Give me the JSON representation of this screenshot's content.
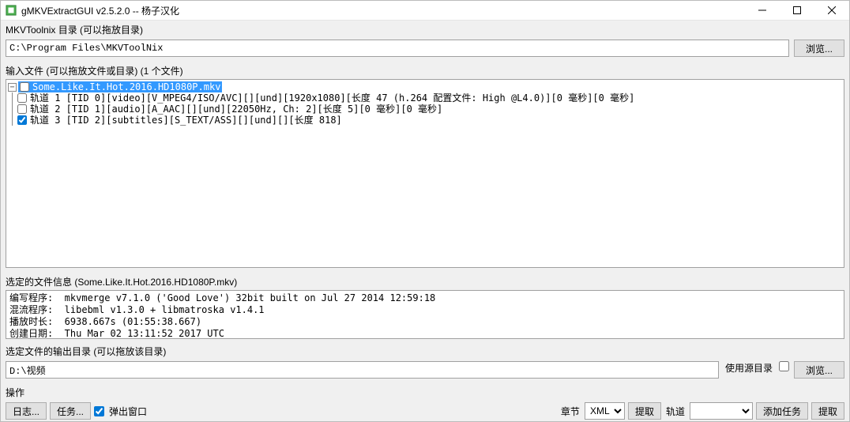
{
  "titlebar": {
    "title": "gMKVExtractGUI v2.5.2.0 -- 杨子汉化"
  },
  "section_mkvtoolnix": {
    "label": "MKVToolnix 目录 (可以拖放目录)",
    "path": "C:\\Program Files\\MKVToolNix",
    "browse": "浏览..."
  },
  "section_input": {
    "label": "输入文件 (可以拖放文件或目录) (1 个文件)"
  },
  "tree": {
    "root": "Some.Like.It.Hot.2016.HD1080P.mkv",
    "tracks": [
      {
        "checked": false,
        "text": "轨道 1 [TID 0][video][V_MPEG4/ISO/AVC][][und][1920x1080][长度 47 (h.264 配置文件: High @L4.0)][0 毫秒][0 毫秒]"
      },
      {
        "checked": false,
        "text": "轨道 2 [TID 1][audio][A_AAC][][und][22050Hz, Ch: 2][长度 5][0 毫秒][0 毫秒]"
      },
      {
        "checked": true,
        "text": "轨道 3 [TID 2][subtitles][S_TEXT/ASS][][und][][长度 818]"
      }
    ]
  },
  "section_fileinfo": {
    "label": "选定的文件信息 (Some.Like.It.Hot.2016.HD1080P.mkv)",
    "lines": [
      "编写程序:  mkvmerge v7.1.0 ('Good Love') 32bit built on Jul 27 2014 12:59:18",
      "混流程序:  libebml v1.3.0 + libmatroska v1.4.1",
      "播放时长:  6938.667s (01:55:38.667)",
      "创建日期:  Thu Mar 02 13:11:52 2017 UTC"
    ]
  },
  "section_output": {
    "label": "选定文件的输出目录 (可以拖放该目录)",
    "path": "D:\\视频",
    "use_source_label": "使用源目录",
    "use_source_checked": false,
    "browse": "浏览..."
  },
  "section_actions": {
    "label": "操作",
    "log": "日志...",
    "tasks": "任务...",
    "popup_label": "弹出窗口",
    "popup_checked": true,
    "chapter_label": "章节",
    "chapter_format": "XML",
    "extract1": "提取",
    "track_label": "轨道",
    "add_task": "添加任务",
    "extract2": "提取"
  }
}
